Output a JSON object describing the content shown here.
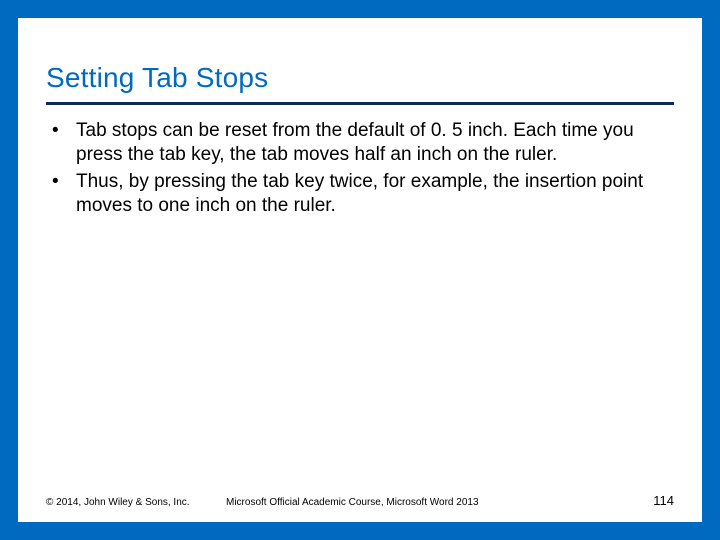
{
  "title": "Setting Tab Stops",
  "bullets": [
    "Tab stops can be reset from the default of 0. 5 inch. Each time you press the tab key, the tab moves half an inch on the ruler.",
    "Thus, by pressing the tab key twice, for example, the insertion point moves to one inch on the ruler."
  ],
  "footer": {
    "copyright": "© 2014, John Wiley & Sons, Inc.",
    "course": "Microsoft Official Academic Course, Microsoft Word 2013",
    "page": "114"
  }
}
